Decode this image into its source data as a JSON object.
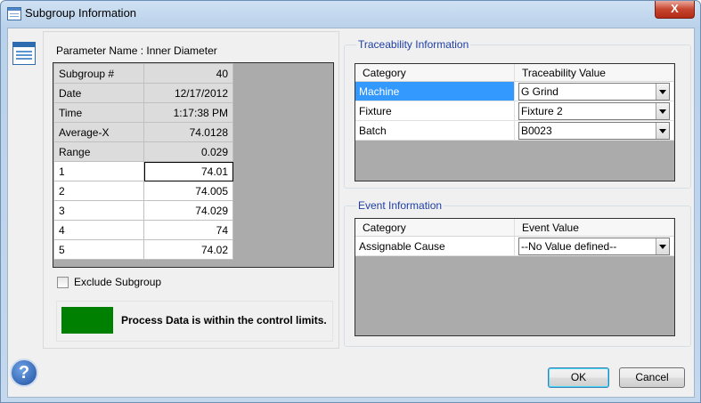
{
  "window": {
    "title": "Subgroup Information",
    "close_label": "X"
  },
  "parameter": {
    "label": "Parameter Name : Inner Diameter"
  },
  "subgroup_grid": {
    "rows": [
      {
        "label": "Subgroup #",
        "value": "40"
      },
      {
        "label": "Date",
        "value": "12/17/2012"
      },
      {
        "label": "Time",
        "value": "1:17:38 PM"
      },
      {
        "label": "Average-X",
        "value": "74.0128"
      },
      {
        "label": "Range",
        "value": "0.029"
      },
      {
        "label": "1",
        "value": "74.01"
      },
      {
        "label": "2",
        "value": "74.005"
      },
      {
        "label": "3",
        "value": "74.029"
      },
      {
        "label": "4",
        "value": "74"
      },
      {
        "label": "5",
        "value": "74.02"
      }
    ]
  },
  "exclude": {
    "label": "Exclude Subgroup",
    "checked": false
  },
  "status": {
    "text": "Process Data is within the control limits.",
    "color": "#008000"
  },
  "traceability": {
    "title": "Traceability Information",
    "headers": [
      "Category",
      "Traceability Value"
    ],
    "rows": [
      {
        "category": "Machine",
        "value": "G Grind"
      },
      {
        "category": "Fixture",
        "value": "Fixture 2"
      },
      {
        "category": "Batch",
        "value": "B0023"
      }
    ]
  },
  "events": {
    "title": "Event Information",
    "headers": [
      "Category",
      "Event Value"
    ],
    "rows": [
      {
        "category": "Assignable Cause",
        "value": "--No Value defined--"
      }
    ]
  },
  "buttons": {
    "ok": "OK",
    "cancel": "Cancel",
    "help": "?"
  }
}
